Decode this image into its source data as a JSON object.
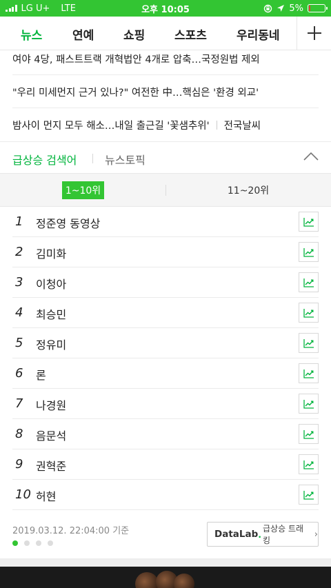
{
  "status": {
    "carrier": "LG U+",
    "network": "LTE",
    "time": "오후 10:05",
    "battery": "5%",
    "battery_level": 0.05,
    "battery_color": "#e53935",
    "icons": [
      "signal-icon",
      "lock-rotation-icon",
      "location-arrow-icon",
      "battery-icon"
    ]
  },
  "nav": {
    "tabs": [
      "뉴스",
      "연예",
      "쇼핑",
      "스포츠",
      "우리동네"
    ],
    "active_tab": "뉴스",
    "plus_icon": "plus-icon"
  },
  "headlines": [
    {
      "text": "여야 4당, 패스트트랙 개혁법안 4개로 압축…국정원법 제외"
    },
    {
      "text": "\"우리 미세먼지 근거 있나?\" 여전한 中…핵심은 '환경 외교'"
    },
    {
      "text": "밤사이 먼지 모두 해소…내일 출근길 '꽃샘추위'",
      "link": "전국날씨"
    }
  ],
  "ranking": {
    "tabs": [
      "급상승 검색어",
      "뉴스토픽"
    ],
    "active_tab": "급상승 검색어",
    "collapse_icon": "chevron-up-icon",
    "pages": [
      "1~10위",
      "11~20위"
    ],
    "active_page": "1~10위",
    "items": [
      {
        "rank": "1",
        "keyword": "정준영 동영상"
      },
      {
        "rank": "2",
        "keyword": "김미화"
      },
      {
        "rank": "3",
        "keyword": "이청아"
      },
      {
        "rank": "4",
        "keyword": "최승민"
      },
      {
        "rank": "5",
        "keyword": "정유미"
      },
      {
        "rank": "6",
        "keyword": "론"
      },
      {
        "rank": "7",
        "keyword": "나경원"
      },
      {
        "rank": "8",
        "keyword": "음문석"
      },
      {
        "rank": "9",
        "keyword": "권혁준"
      },
      {
        "rank": "10",
        "keyword": "허현"
      }
    ],
    "trend_icon": "trend-chart-icon",
    "timestamp": "2019.03.12. 22:04:00 기준",
    "pager_dots": 4,
    "active_dot": 1,
    "datalab": {
      "brand": "DataLab",
      "dot": ".",
      "label": "급상승 트래킹",
      "chevron": "›"
    }
  },
  "colors": {
    "accent": "#00b43c",
    "status_bar": "#33c533",
    "text": "#222222"
  }
}
